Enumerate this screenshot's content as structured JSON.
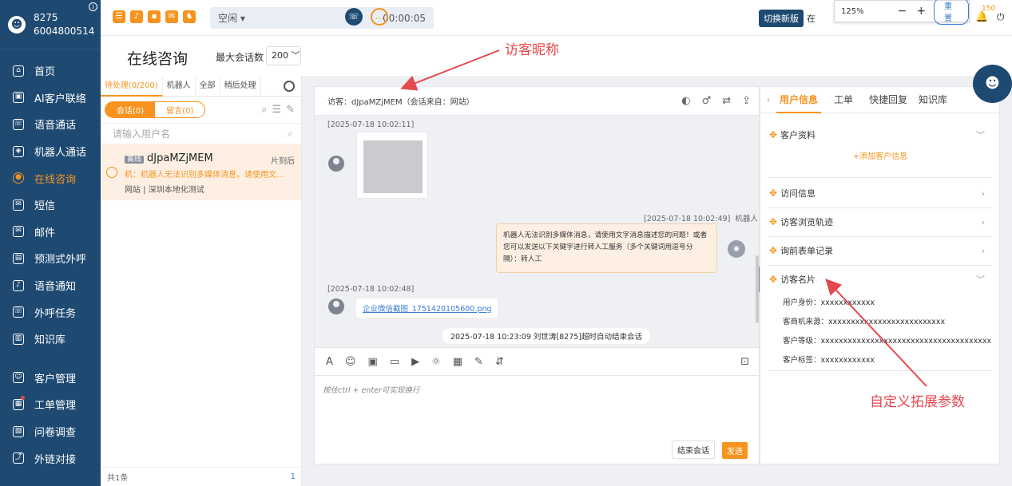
{
  "sidebar": {
    "user_id": "8275",
    "user_phone": "6004800514",
    "info_glyph": "i",
    "items": [
      {
        "label": "首页",
        "glyph": "⌂"
      },
      {
        "label": "AI客户联络",
        "glyph": "▣"
      },
      {
        "label": "语音通话",
        "glyph": "☏"
      },
      {
        "label": "机器人通话",
        "glyph": "◈"
      },
      {
        "label": "在线咨询",
        "glyph": "●"
      },
      {
        "label": "短信",
        "glyph": "✉"
      },
      {
        "label": "邮件",
        "glyph": "✉"
      },
      {
        "label": "预测式外呼",
        "glyph": "▤"
      },
      {
        "label": "语音通知",
        "glyph": "♪"
      },
      {
        "label": "外呼任务",
        "glyph": "☏"
      },
      {
        "label": "知识库",
        "glyph": "▥"
      },
      {
        "label": "客户管理",
        "glyph": "☺"
      },
      {
        "label": "工单管理",
        "glyph": "▦"
      },
      {
        "label": "问卷调查",
        "glyph": "▧"
      },
      {
        "label": "外链对接",
        "glyph": "⤴"
      }
    ]
  },
  "topbar": {
    "icons": [
      "☰",
      "♪",
      "▪",
      "✉",
      "♞"
    ],
    "status": "空闲",
    "status_arrow": "▾",
    "timer": "00:00:05",
    "phone_glyph": "☏",
    "chat_glyph": "…",
    "switch_label": "切换新版",
    "online_label": "在",
    "zoom": {
      "value": "125%",
      "minus": "−",
      "plus": "+",
      "reset": "重置"
    },
    "bell_glyph": "🔔",
    "notification_count": "150",
    "power_glyph": "⏻"
  },
  "page": {
    "title": "在线咨询",
    "max_sessions_label": "最大会话数",
    "max_sessions_value": "200",
    "annotation_nickname": "访客昵称",
    "annotation_custom": "自定义拓展参数"
  },
  "sessions": {
    "tabs": [
      "待处理(0/200)",
      "机器人",
      "全部",
      "稍后处理"
    ],
    "segments": [
      "会话(0)",
      "留言(0)"
    ],
    "tool_glyphs": [
      "⌕",
      "☰",
      "✎"
    ],
    "search_placeholder": "请输入用户名",
    "search_glyph": "⌕",
    "item": {
      "badge": "离线",
      "name": "dJpaMZjMEM",
      "time": "片刻后",
      "message": "机：机器人无法识别多媒体消息，请使用文...",
      "source": "网站 | 深圳本地化测试"
    },
    "footer_total": "共1条",
    "footer_page": "1"
  },
  "chat": {
    "header": "访客：dJpaMZjMEM（会话来自：网站）",
    "header_tools": [
      "◐",
      "♂",
      "⇄",
      "⇪"
    ],
    "ts1": "[2025-07-18 10:02:11]",
    "ts2": "[2025-07-18 10:02:49]",
    "ts2_sender": "机器人",
    "robot_message": "机器人无法识别多媒体消息，请使用文字消息描述您的问题！或者您可以发送以下关键字进行转人工服务（多个关键词用逗号分隔）：转人工",
    "robot_glyph": "◉",
    "ts3": "[2025-07-18 10:02:48]",
    "file_name": "企业微信截图_1751420105600.png",
    "system_message": "2025-07-18 10:23:09 刘世涛[8275]超时自动结束会话",
    "toolbar_glyphs": [
      "A",
      "☺",
      "▣",
      "▭",
      "▶",
      "☼",
      "▦",
      "✎",
      "⇵"
    ],
    "lock_glyph": "⊡",
    "input_placeholder": "按住ctrl + enter可实现换行",
    "end_label": "结束会话",
    "send_label": "发送",
    "handle_glyph": "›"
  },
  "info": {
    "prev_glyph": "‹",
    "tabs": [
      "用户信息",
      "工单",
      "快捷回复",
      "知识库"
    ],
    "move_glyph": "✥",
    "sections": [
      {
        "title": "客户资料",
        "chevron": "﹀"
      },
      {
        "title": "访问信息",
        "chevron": "›"
      },
      {
        "title": "访客浏览轨迹",
        "chevron": "›"
      },
      {
        "title": "询前表单记录",
        "chevron": "›"
      },
      {
        "title": "访客名片",
        "chevron": "﹀"
      }
    ],
    "add_customer": "+添加客户信息",
    "card_fields": [
      "用户身份：xxxxxxxxxxxx",
      "客商机来源：xxxxxxxxxxxxxxxxxxxxxxxxxx",
      "客户等级：xxxxxxxxxxxxxxxxxxxxxxxxxxxxxxxxxxxxxxxxx",
      "客户标签：xxxxxxxxxxxx"
    ]
  },
  "bot_glyph": "☻",
  "colors": {
    "accent": "#f7931e",
    "sidebar": "#1e4a72",
    "annotation": "#e5484d"
  }
}
